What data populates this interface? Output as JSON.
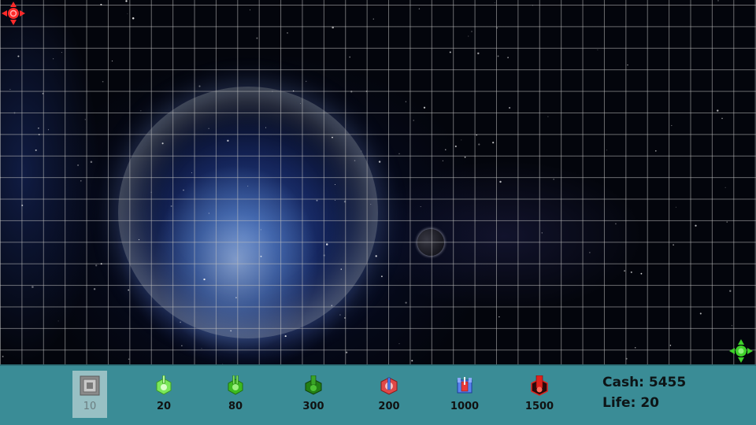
{
  "towers": [
    {
      "name": "wall-block",
      "price": "10",
      "color": "#9a9a9a",
      "selected": true
    },
    {
      "name": "light-green-turret",
      "price": "20",
      "color": "#6ee04a"
    },
    {
      "name": "green-turret",
      "price": "80",
      "color": "#3dbb1f"
    },
    {
      "name": "dark-green-turret",
      "price": "300",
      "color": "#237f14"
    },
    {
      "name": "red-blue-turret",
      "price": "200",
      "color": "#e04040"
    },
    {
      "name": "blue-red-turret",
      "price": "1000",
      "color": "#3a6fe0"
    },
    {
      "name": "red-heavy-turret",
      "price": "1500",
      "color": "#e0221c"
    }
  ],
  "stats": {
    "cash_label": "Cash:",
    "cash_value": "5455",
    "life_label": "Life:",
    "life_value": "20"
  },
  "markers": {
    "spawn_color": "#ff2a2a",
    "exit_color": "#3ed12a"
  }
}
